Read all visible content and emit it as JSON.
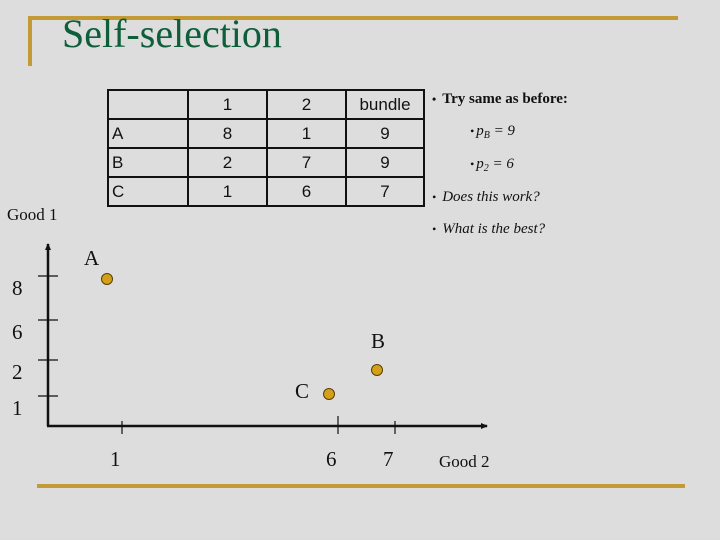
{
  "slide": {
    "title": "Self-selection",
    "accent_color": "#c49a34",
    "title_color": "#0f5e3a"
  },
  "table": {
    "headers": [
      "",
      "1",
      "2",
      "bundle"
    ],
    "rows": [
      {
        "label": "A",
        "good1": "8",
        "good2": "1",
        "bundle": "9"
      },
      {
        "label": "B",
        "good1": "2",
        "good2": "7",
        "bundle": "9"
      },
      {
        "label": "C",
        "good1": "1",
        "good2": "6",
        "bundle": "7"
      }
    ]
  },
  "bullets": {
    "item1": "Try same as before:",
    "sub1": {
      "var": "p",
      "subscript": "B",
      "rest": " = 9"
    },
    "sub2": {
      "var": "p",
      "subscript": "2",
      "rest": " = 6"
    },
    "item2": "Does this work?",
    "item3": "What is the best?"
  },
  "chart_data": {
    "type": "scatter",
    "title": "",
    "xlabel": "Good 2",
    "ylabel": "Good 1",
    "x_ticks": [
      1,
      6,
      7
    ],
    "y_ticks": [
      8,
      6,
      2,
      1
    ],
    "points": [
      {
        "label": "A",
        "x": 1,
        "y": 8
      },
      {
        "label": "B",
        "x": 7,
        "y": 2
      },
      {
        "label": "C",
        "x": 6,
        "y": 1
      }
    ],
    "point_color": "#d4a017",
    "grid": false,
    "legend": "none"
  }
}
